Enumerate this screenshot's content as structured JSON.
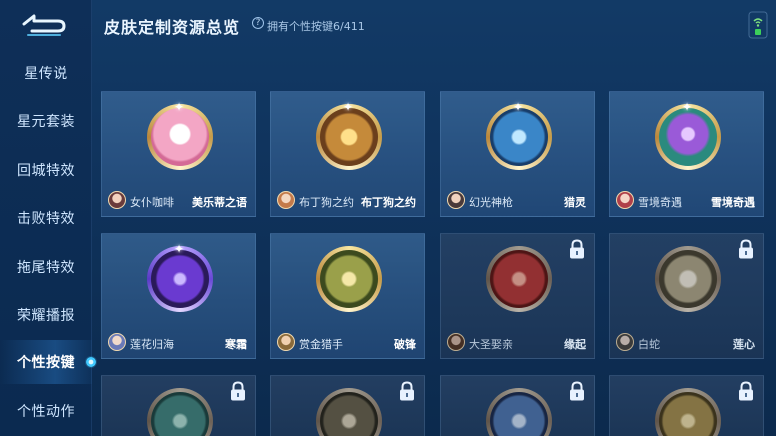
{
  "header": {
    "title": "皮肤定制资源总览",
    "help_icon": "?",
    "count_text": "拥有个性按键6/411"
  },
  "sidebar": {
    "items": [
      {
        "label": "星传说"
      },
      {
        "label": "星元套装"
      },
      {
        "label": "回城特效"
      },
      {
        "label": "击败特效"
      },
      {
        "label": "拖尾特效"
      },
      {
        "label": "荣耀播报"
      },
      {
        "label": "个性按键"
      },
      {
        "label": "个性动作"
      }
    ],
    "active_index": 6
  },
  "cards": [
    {
      "hero": "女仆咖啡",
      "skin": "美乐蒂之语",
      "locked": false,
      "icon": "pink-bunny-doll-icon",
      "inner": "#e98ab0"
    },
    {
      "hero": "布丁狗之约",
      "skin": "布丁狗之约",
      "locked": false,
      "icon": "golden-bow-wand-icon",
      "inner": "#8a5a2a"
    },
    {
      "hero": "幻光神枪",
      "skin": "猎灵",
      "locked": false,
      "icon": "crystal-spear-icon",
      "inner": "#2a6aa8"
    },
    {
      "hero": "雪境奇遇",
      "skin": "雪境奇遇",
      "locked": false,
      "icon": "purple-lotus-icon",
      "inner": "#2b8a7e"
    },
    {
      "hero": "莲花归海",
      "skin": "寒霜",
      "locked": false,
      "icon": "crescent-blade-icon",
      "inner": "#4c2f8a"
    },
    {
      "hero": "赏金猎手",
      "skin": "破锋",
      "locked": false,
      "icon": "golden-feather-sword-icon",
      "inner": "#4a6a2a"
    },
    {
      "hero": "大圣娶亲",
      "skin": "缘起",
      "locked": true,
      "icon": "red-scroll-icon",
      "inner": "#a82a2a"
    },
    {
      "hero": "白蛇",
      "skin": "莲心",
      "locked": true,
      "icon": "white-snake-lotus-icon",
      "inner": "#6b6650"
    },
    {
      "hero": "",
      "skin": "",
      "locked": true,
      "icon": "teal-crest-icon",
      "inner": "#2a6a66"
    },
    {
      "hero": "",
      "skin": "",
      "locked": true,
      "icon": "bronze-blade-icon",
      "inner": "#4a4a3a"
    },
    {
      "hero": "",
      "skin": "",
      "locked": true,
      "icon": "blue-wing-icon",
      "inner": "#2a4a7a"
    },
    {
      "hero": "",
      "skin": "",
      "locked": true,
      "icon": "golden-ornament-icon",
      "inner": "#6a5a2a"
    }
  ]
}
